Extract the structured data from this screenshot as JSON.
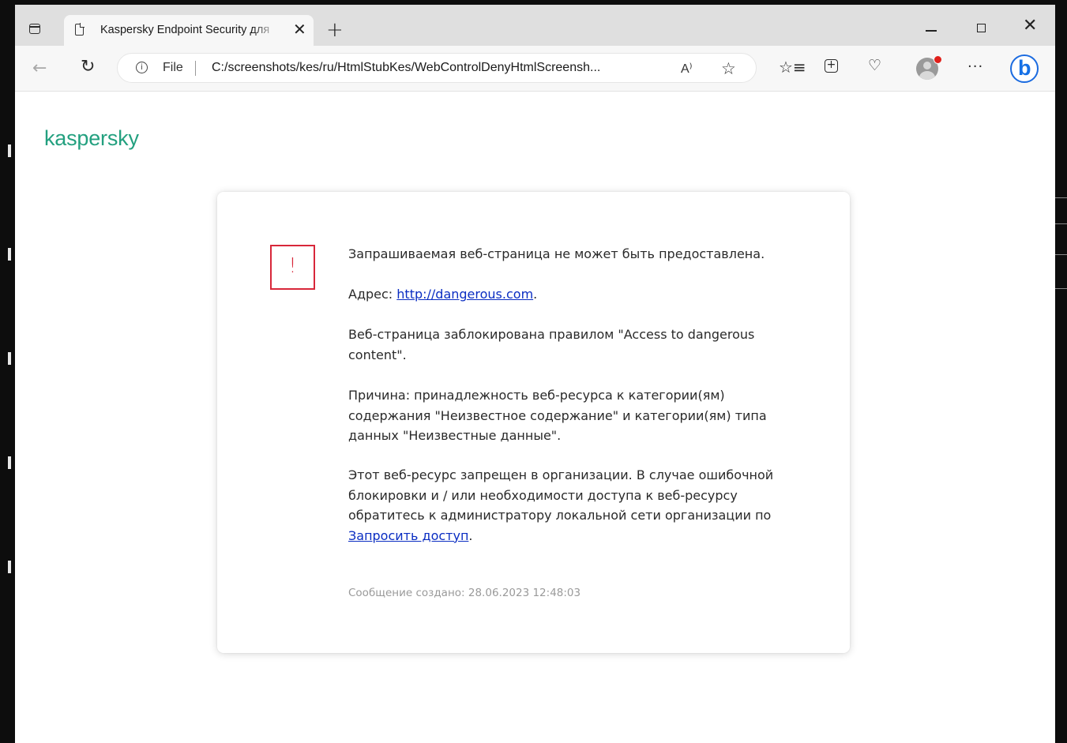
{
  "browser": {
    "tab_title": "Kaspersky Endpoint Security для",
    "tab_close": "✕",
    "new_tab": "+",
    "window": {
      "minimize": "",
      "maximize": "",
      "close": "✕"
    },
    "address": {
      "scheme_label": "File",
      "url": "C:/screenshots/kes/ru/HtmlStubKes/WebControlDenyHtmlScreensh..."
    },
    "read_aloud": "A⁾",
    "more": "···",
    "bing": "b"
  },
  "page": {
    "logo": "kaspersky",
    "warning_symbol": "!",
    "heading": "Запрашиваемая веб-страница не может быть предоставлена.",
    "address_label": "Адрес: ",
    "address_link": "http://dangerous.com",
    "address_suffix": ".",
    "rule_text": "Веб-страница заблокирована правилом \"Access to dangerous content\".",
    "reason_text": "Причина: принадлежность веб-ресурса к категории(ям) содержания \"Неизвестное содержание\" и категории(ям) типа данных \"Неизвестные данные\".",
    "org_text": "Этот веб-ресурс запрещен в организации. В случае ошибочной блокировки и / или необходимости доступа к веб-ресурсу обратитесь к администратору локальной сети организации по ",
    "request_link": "Запросить доступ",
    "org_suffix": ".",
    "footer": "Сообщение создано: 28.06.2023 12:48:03"
  },
  "colors": {
    "brand": "#23a07f",
    "warning": "#d8273a",
    "link": "#0a2dc2"
  }
}
